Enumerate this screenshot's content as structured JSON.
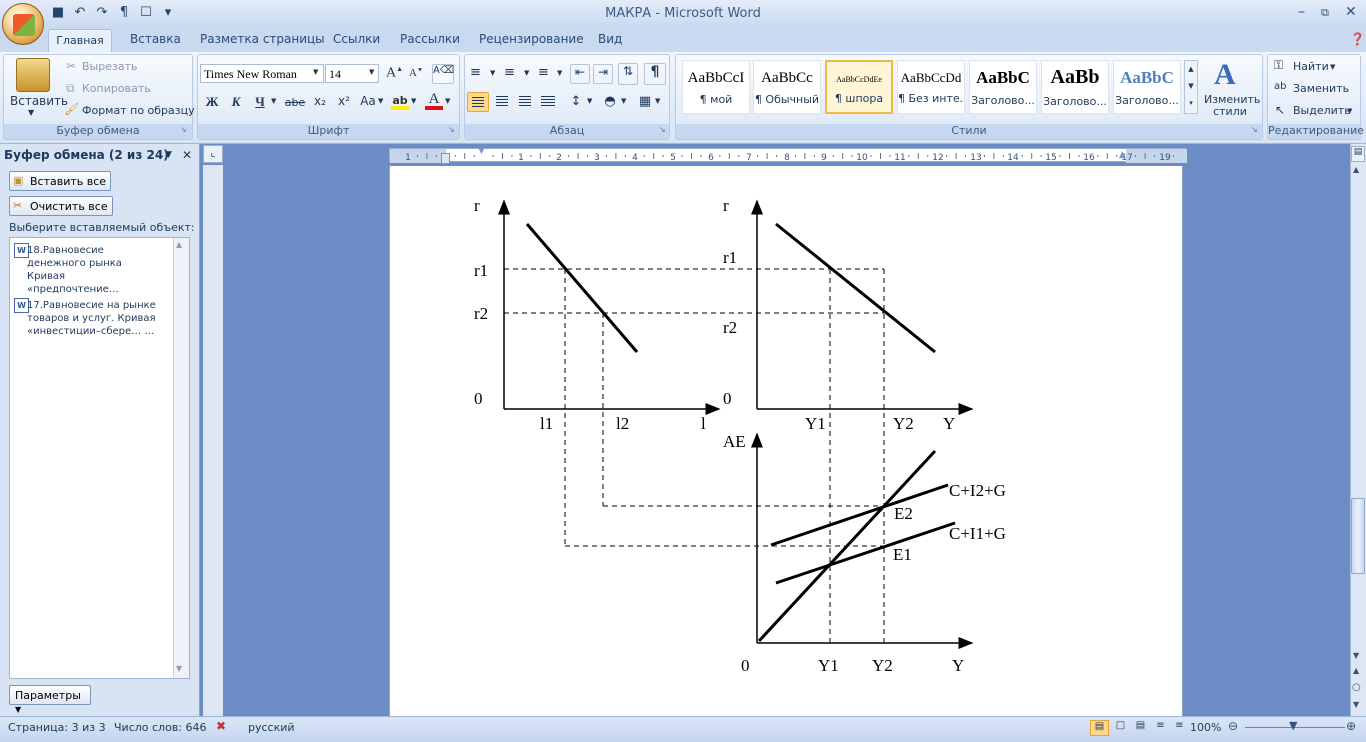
{
  "window": {
    "title": "МАКРА - Microsoft Word"
  },
  "quick_access": {
    "save": "save-icon",
    "undo": "undo-icon",
    "redo": "redo-icon",
    "pilcrow": "¶"
  },
  "tabs": [
    "Главная",
    "Вставка",
    "Разметка страницы",
    "Ссылки",
    "Рассылки",
    "Рецензирование",
    "Вид"
  ],
  "clipboard_group": {
    "paste": "Вставить",
    "cut": "Вырезать",
    "copy": "Копировать",
    "format_painter": "Формат по образцу",
    "label": "Буфер обмена"
  },
  "font_group": {
    "font": "Times New Roman",
    "size": "14",
    "bold": "Ж",
    "italic": "К",
    "underline": "Ч",
    "strike": "abe",
    "sub": "x₂",
    "sup": "x²",
    "case": "Aa",
    "label": "Шрифт"
  },
  "paragraph_group": {
    "label": "Абзац"
  },
  "styles_group": {
    "label": "Стили",
    "tiles": [
      {
        "sample": "AaBbCcI",
        "name": "¶ мой"
      },
      {
        "sample": "AaBbCc",
        "name": "¶ Обычный"
      },
      {
        "sample": "AaBbCcDdEe",
        "name": "¶ шпора"
      },
      {
        "sample": "AaBbCcDd",
        "name": "¶ Без инте..."
      },
      {
        "sample": "AaBbC",
        "name": "Заголово..."
      },
      {
        "sample": "AaBb",
        "name": "Заголово..."
      },
      {
        "sample": "AaBbC",
        "name": "Заголово..."
      }
    ],
    "change": "Изменить стили"
  },
  "editing_group": {
    "find": "Найти",
    "replace": "Заменить",
    "select": "Выделить",
    "label": "Редактирование"
  },
  "clipboard_pane": {
    "title": "Буфер обмена (2 из 24)",
    "paste_all": "Вставить все",
    "clear_all": "Очистить все",
    "prompt": "Выберите вставляемый объект:",
    "items": [
      {
        "line1": "18.Равновесие",
        "line2": "денежного рынка",
        "line3": "Кривая «предпочтение…"
      },
      {
        "line1": "17.Равновесие на рынке",
        "line2": "товаров и услуг. Кривая",
        "line3": "«инвестиции–сбере… …"
      }
    ],
    "options": "Параметры"
  },
  "ruler": {
    "numbers": [
      "1",
      "1",
      "2",
      "3",
      "4",
      "5",
      "6",
      "7",
      "8",
      "9",
      "10",
      "11",
      "12",
      "13",
      "14",
      "15",
      "16",
      "17",
      "19"
    ]
  },
  "diagram": {
    "left_top": {
      "y_label": "r",
      "x_label": "l",
      "origin": "0",
      "r1": "r1",
      "r2": "r2",
      "l1": "l1",
      "l2": "l2"
    },
    "right_top": {
      "y_label": "r",
      "x_label": "Y",
      "origin": "0",
      "r1": "r1",
      "r2": "r2",
      "y1": "Y1",
      "y2": "Y2"
    },
    "bottom": {
      "y_label": "AE",
      "x_label": "Y",
      "origin": "0",
      "y1": "Y1",
      "y2": "Y2",
      "line_high": "C+I2+G",
      "line_low": "C+I1+G",
      "e1": "E1",
      "e2": "E2"
    }
  },
  "status": {
    "page": "Страница: 3 из 3",
    "words": "Число слов: 646",
    "language": "русский",
    "zoom": "100%"
  }
}
